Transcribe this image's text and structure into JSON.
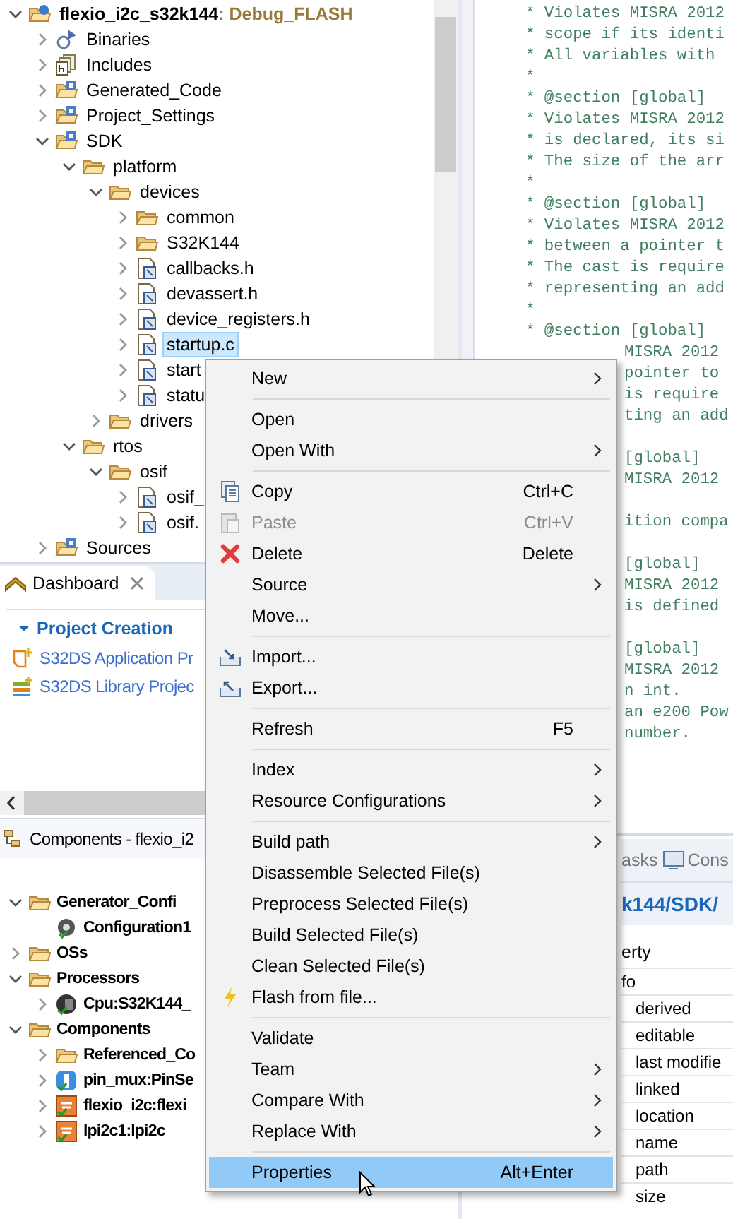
{
  "project_tree": {
    "root": {
      "label": "flexio_i2c_s32k144",
      "config": ": Debug_FLASH",
      "expanded": true,
      "selected": false,
      "children": [
        {
          "label": "Binaries",
          "kind": "binaries",
          "expanded": false,
          "selected": false
        },
        {
          "label": "Includes",
          "kind": "includes",
          "expanded": false,
          "selected": false
        },
        {
          "label": "Generated_Code",
          "kind": "source-folder",
          "expanded": false,
          "selected": false
        },
        {
          "label": "Project_Settings",
          "kind": "source-folder",
          "expanded": false,
          "selected": false
        },
        {
          "label": "SDK",
          "kind": "source-folder",
          "expanded": true,
          "selected": false,
          "children": [
            {
              "label": "platform",
              "kind": "folder",
              "expanded": true,
              "selected": false,
              "children": [
                {
                  "label": "devices",
                  "kind": "folder",
                  "expanded": true,
                  "selected": false,
                  "children": [
                    {
                      "label": "common",
                      "kind": "folder",
                      "expanded": false,
                      "selected": false
                    },
                    {
                      "label": "S32K144",
                      "kind": "folder",
                      "expanded": false,
                      "selected": false
                    },
                    {
                      "label": "callbacks.h",
                      "kind": "header",
                      "expanded": false,
                      "selected": false
                    },
                    {
                      "label": "devassert.h",
                      "kind": "header",
                      "expanded": false,
                      "selected": false
                    },
                    {
                      "label": "device_registers.h",
                      "kind": "header",
                      "expanded": false,
                      "selected": false
                    },
                    {
                      "label": "startup.c",
                      "kind": "source",
                      "expanded": false,
                      "selected": true
                    },
                    {
                      "label": "start",
                      "kind": "header",
                      "expanded": false,
                      "selected": false
                    },
                    {
                      "label": "statu",
                      "kind": "header",
                      "expanded": false,
                      "selected": false
                    }
                  ]
                },
                {
                  "label": "drivers",
                  "kind": "folder",
                  "expanded": false,
                  "selected": false
                }
              ]
            },
            {
              "label": "rtos",
              "kind": "folder",
              "expanded": true,
              "selected": false,
              "children": [
                {
                  "label": "osif",
                  "kind": "folder",
                  "expanded": true,
                  "selected": false,
                  "children": [
                    {
                      "label": "osif_",
                      "kind": "source",
                      "expanded": false,
                      "selected": false
                    },
                    {
                      "label": "osif.",
                      "kind": "header",
                      "expanded": false,
                      "selected": false
                    }
                  ]
                }
              ]
            }
          ]
        },
        {
          "label": "Sources",
          "kind": "source-folder",
          "expanded": false,
          "selected": false
        }
      ]
    }
  },
  "dashboard": {
    "tab": "Dashboard",
    "section": "Project Creation",
    "section_expanded": true,
    "links": [
      "S32DS Application Pr",
      "S32DS Library Projec"
    ]
  },
  "components": {
    "tab": "Components - flexio_i2",
    "tree": [
      {
        "label": "Generator_Confi",
        "kind": "folder",
        "expanded": true,
        "children": [
          {
            "label": "Configuration1",
            "kind": "gear"
          }
        ]
      },
      {
        "label": "OSs",
        "kind": "folder",
        "expanded": false
      },
      {
        "label": "Processors",
        "kind": "folder",
        "expanded": true,
        "children": [
          {
            "label": "Cpu:S32K144_",
            "kind": "cpu",
            "expanded": false
          }
        ]
      },
      {
        "label": "Components",
        "kind": "folder",
        "expanded": true,
        "children": [
          {
            "label": "Referenced_Co",
            "kind": "folder",
            "expanded": false
          },
          {
            "label": "pin_mux:PinSe",
            "kind": "pin",
            "expanded": false
          },
          {
            "label": "flexio_i2c:flexi",
            "kind": "component",
            "expanded": false
          },
          {
            "label": "lpi2c1:lpi2c",
            "kind": "component",
            "expanded": false
          }
        ]
      }
    ]
  },
  "editor": {
    "lines": [
      {
        "kind": "full",
        "text": "* Violates MISRA 2012"
      },
      {
        "kind": "full",
        "text": "* scope if its identi"
      },
      {
        "kind": "full",
        "text": "* All variables with"
      },
      {
        "kind": "full",
        "text": "*"
      },
      {
        "kind": "full",
        "text": "* @section [global]"
      },
      {
        "kind": "full",
        "text": "* Violates MISRA 2012"
      },
      {
        "kind": "full",
        "text": "* is declared, its si"
      },
      {
        "kind": "full",
        "text": "* The size of the arr"
      },
      {
        "kind": "full",
        "text": "*"
      },
      {
        "kind": "full",
        "text": "* @section [global]"
      },
      {
        "kind": "full",
        "text": "* Violates MISRA 2012"
      },
      {
        "kind": "full",
        "text": "* between a pointer t"
      },
      {
        "kind": "full",
        "text": "* The cast is require"
      },
      {
        "kind": "full",
        "text": "* representing an add"
      },
      {
        "kind": "full",
        "text": "*"
      },
      {
        "kind": "full",
        "text": "* @section [global]"
      },
      {
        "kind": "clipped",
        "text": "MISRA 2012"
      },
      {
        "kind": "clipped",
        "text": "pointer to"
      },
      {
        "kind": "clipped",
        "text": "is require"
      },
      {
        "kind": "clipped",
        "text": "ting an add"
      },
      {
        "kind": "clipped"
      },
      {
        "kind": "clipped",
        "text": "[global]"
      },
      {
        "kind": "clipped",
        "text": "MISRA 2012"
      },
      {
        "kind": "clipped"
      },
      {
        "kind": "clipped",
        "text": "ition compa"
      },
      {
        "kind": "clipped"
      },
      {
        "kind": "clipped",
        "text": "[global]"
      },
      {
        "kind": "clipped",
        "text": "MISRA 2012"
      },
      {
        "kind": "clipped",
        "text": "is defined"
      },
      {
        "kind": "clipped"
      },
      {
        "kind": "clipped",
        "text": "[global]"
      },
      {
        "kind": "clipped",
        "text": "MISRA 2012"
      },
      {
        "kind": "clipped",
        "text": "n int."
      },
      {
        "kind": "clipped",
        "text": "an e200 Pow"
      },
      {
        "kind": "clipped",
        "text": "number."
      }
    ]
  },
  "properties": {
    "tabs": [
      {
        "label": "asks",
        "selected": false
      },
      {
        "label": "Cons",
        "selected": false
      }
    ],
    "path": "k144/SDK/",
    "header": "erty",
    "group": "fo",
    "rows": [
      "derived",
      "editable",
      "last modifie",
      "linked",
      "location",
      "name",
      "path",
      "size"
    ]
  },
  "context_menu": [
    {
      "kind": "item",
      "label": "New",
      "submenu": true,
      "disabled": false,
      "selected": false
    },
    {
      "kind": "separator"
    },
    {
      "kind": "item",
      "label": "Open",
      "submenu": false,
      "disabled": false,
      "selected": false
    },
    {
      "kind": "item",
      "label": "Open With",
      "submenu": true,
      "disabled": false,
      "selected": false
    },
    {
      "kind": "separator"
    },
    {
      "kind": "item",
      "label": "Copy",
      "shortcut": "Ctrl+C",
      "submenu": false,
      "disabled": false,
      "selected": false
    },
    {
      "kind": "item",
      "label": "Paste",
      "shortcut": "Ctrl+V",
      "submenu": false,
      "disabled": true,
      "selected": false
    },
    {
      "kind": "item",
      "label": "Delete",
      "shortcut": "Delete",
      "submenu": false,
      "disabled": false,
      "selected": false
    },
    {
      "kind": "item",
      "label": "Source",
      "submenu": true,
      "disabled": false,
      "selected": false
    },
    {
      "kind": "item",
      "label": "Move...",
      "submenu": false,
      "disabled": false,
      "selected": false
    },
    {
      "kind": "separator"
    },
    {
      "kind": "item",
      "label": "Import...",
      "submenu": false,
      "disabled": false,
      "selected": false
    },
    {
      "kind": "item",
      "label": "Export...",
      "submenu": false,
      "disabled": false,
      "selected": false
    },
    {
      "kind": "separator"
    },
    {
      "kind": "item",
      "label": "Refresh",
      "shortcut": "F5",
      "submenu": false,
      "disabled": false,
      "selected": false
    },
    {
      "kind": "separator"
    },
    {
      "kind": "item",
      "label": "Index",
      "submenu": true,
      "disabled": false,
      "selected": false
    },
    {
      "kind": "item",
      "label": "Resource Configurations",
      "submenu": true,
      "disabled": false,
      "selected": false
    },
    {
      "kind": "separator"
    },
    {
      "kind": "item",
      "label": "Build path",
      "submenu": true,
      "disabled": false,
      "selected": false
    },
    {
      "kind": "item",
      "label": "Disassemble Selected File(s)",
      "submenu": false,
      "disabled": false,
      "selected": false
    },
    {
      "kind": "item",
      "label": "Preprocess Selected File(s)",
      "submenu": false,
      "disabled": false,
      "selected": false
    },
    {
      "kind": "item",
      "label": "Build Selected File(s)",
      "submenu": false,
      "disabled": false,
      "selected": false
    },
    {
      "kind": "item",
      "label": "Clean Selected File(s)",
      "submenu": false,
      "disabled": false,
      "selected": false
    },
    {
      "kind": "item",
      "label": "Flash from file...",
      "submenu": false,
      "disabled": false,
      "selected": false
    },
    {
      "kind": "separator"
    },
    {
      "kind": "item",
      "label": "Validate",
      "submenu": false,
      "disabled": false,
      "selected": false
    },
    {
      "kind": "item",
      "label": "Team",
      "submenu": true,
      "disabled": false,
      "selected": false
    },
    {
      "kind": "item",
      "label": "Compare With",
      "submenu": true,
      "disabled": false,
      "selected": false
    },
    {
      "kind": "item",
      "label": "Replace With",
      "submenu": true,
      "disabled": false,
      "selected": false
    },
    {
      "kind": "separator"
    },
    {
      "kind": "item",
      "label": "Properties",
      "shortcut": "Alt+Enter",
      "submenu": false,
      "disabled": false,
      "selected": true
    }
  ]
}
